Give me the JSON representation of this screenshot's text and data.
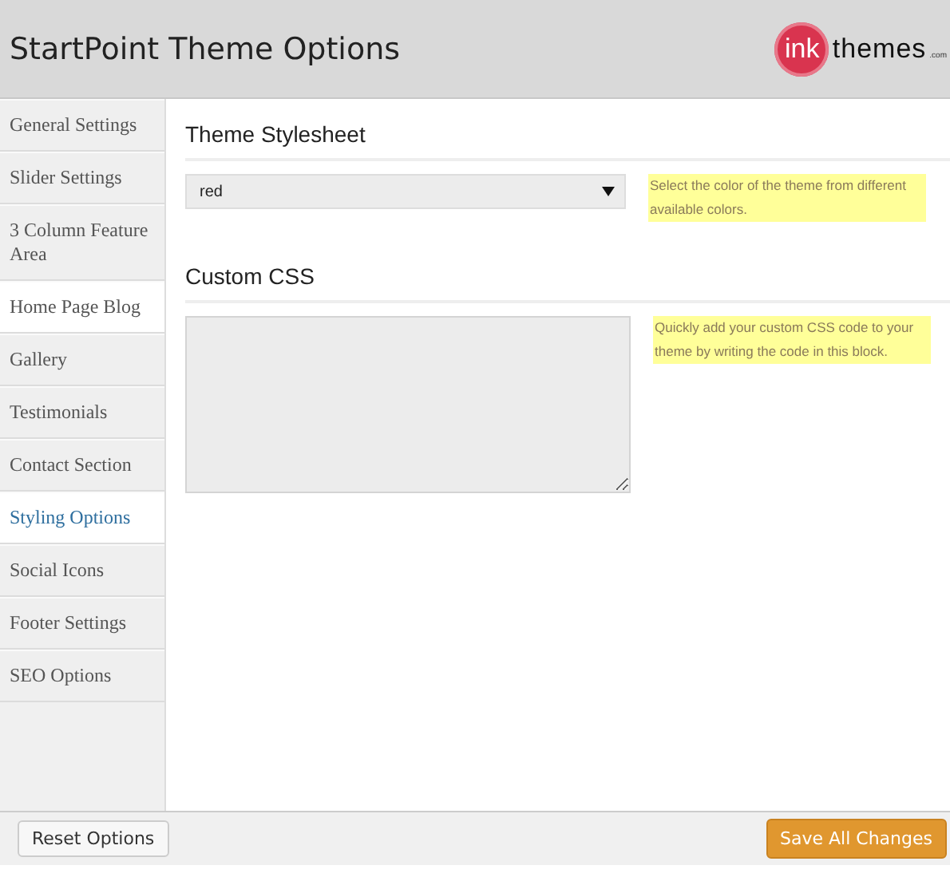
{
  "header": {
    "title": "StartPoint Theme Options",
    "logo": {
      "mark": "ink",
      "word": "themes",
      "suffix": ".com"
    }
  },
  "sidebar": {
    "items": [
      {
        "label": "General Settings",
        "selected": false,
        "hovered": false
      },
      {
        "label": "Slider Settings",
        "selected": false,
        "hovered": false
      },
      {
        "label": "3 Column Feature Area",
        "selected": false,
        "hovered": false
      },
      {
        "label": "Home Page Blog",
        "selected": false,
        "hovered": true
      },
      {
        "label": "Gallery",
        "selected": false,
        "hovered": false
      },
      {
        "label": "Testimonials",
        "selected": false,
        "hovered": false
      },
      {
        "label": "Contact Section",
        "selected": false,
        "hovered": false
      },
      {
        "label": "Styling Options",
        "selected": true,
        "hovered": false
      },
      {
        "label": "Social Icons",
        "selected": false,
        "hovered": false
      },
      {
        "label": "Footer Settings",
        "selected": false,
        "hovered": false
      },
      {
        "label": "SEO Options",
        "selected": false,
        "hovered": false
      }
    ]
  },
  "sections": [
    {
      "kind": "select",
      "heading": "Theme Stylesheet",
      "value": "red",
      "help": "Select the color of the theme from different available colors."
    },
    {
      "kind": "textarea",
      "heading": "Custom CSS",
      "help": "Quickly add your custom CSS code to your theme by writing the code in this block."
    }
  ],
  "footer": {
    "reset_button": "Reset Options",
    "save_button": "Save All Changes"
  }
}
